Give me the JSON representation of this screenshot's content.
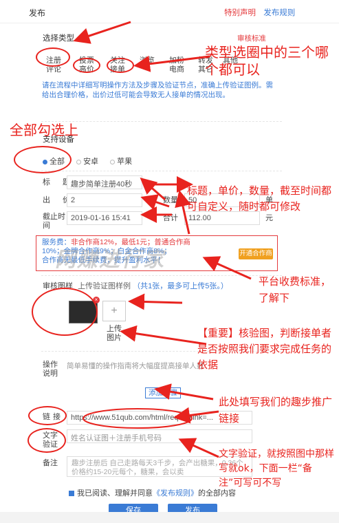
{
  "header": {
    "title": "发布",
    "special_notice": "特别声明",
    "publish_rules": "发布规则"
  },
  "type_section": {
    "label": "选择类型",
    "audit_standard": "审核标准",
    "row1": [
      "注册",
      "投票",
      "关注",
      "浏览",
      "加粉",
      "转发",
      "其他"
    ],
    "row2": [
      "评论",
      "高价",
      "接单",
      "电商",
      "其它"
    ],
    "note": "请在流程中详细写明操作方法及步骤及验证节点，准确上传验证图例。需给出合理价格，出价过低可能会导致无人接单的情况出现。"
  },
  "device_section": {
    "label": "支持设备",
    "options": [
      "全部",
      "安卓",
      "苹果"
    ],
    "selected": "全部"
  },
  "form": {
    "title_label": "标题",
    "title_value": "趣步简单注册40秒",
    "price_label": "出价",
    "price_value": "2",
    "count_label": "数量",
    "count_value": "50",
    "count_unit": "单",
    "deadline_label": "截止时间",
    "deadline_value": "2019-01-16 15:41",
    "total_label": "合计",
    "total_value": "112.00",
    "total_unit": "元"
  },
  "fee": {
    "line1_prefix": "服务费：",
    "line1_red": "非合作商12%，最低1元；普通合作商",
    "line2": "10%；金牌合作商9%；白金合作商8%；",
    "line3": "合作商无最低手续费，提升盈利水平！",
    "upgrade_button": "开通合作商",
    "watermark": "网赚进行家"
  },
  "audit_image": {
    "label": "审核图样",
    "upload_hint": "上传验证图样例",
    "limit": "（共1张，最多可上传5张。）",
    "upload_plus": "+",
    "upload_text": "上传图片"
  },
  "steps": {
    "label": "操作说明",
    "placeholder": "简单易懂的操作指南将大幅度提高接单人数",
    "add_step": "添加步骤"
  },
  "link": {
    "label": "链接",
    "value": "https://www.51qub.com/html/req?onlink=..."
  },
  "text_verify": {
    "label": "文字验证",
    "placeholder": "姓名认证图＋注册手机号码"
  },
  "remark": {
    "label": "备注",
    "placeholder": "趣步注册后 自己走路每天3千步，会产出糖果，0.36个价格约15-20元每个，糖果，会以卖"
  },
  "agreement": {
    "prefix": "我已阅读、理解并同意",
    "rules_link": "《发布规则》",
    "suffix": "的全部内容"
  },
  "buttons": {
    "save": "保存",
    "publish": "发布"
  },
  "annotations": {
    "type_circle": "类型选圈中的三个哪个都可以",
    "select_all": "全部勾选上",
    "custom_fields": "标题，单价，数量，截至时间都可自定义，随时都可修改",
    "fee_note": "平台收费标准，了解下",
    "verify_image": "【重要】核验图，判断接单者是否按照我们要求完成任务的依据",
    "link_note": "此处填写我们的趣步推广链接",
    "text_note": "文字验证，就按照图中那样写就ok，下面一栏“备注”可写可不写"
  },
  "colors": {
    "accent_blue": "#3a7bd5",
    "annotation_red": "#e8231e",
    "button_orange": "#f0a020"
  }
}
